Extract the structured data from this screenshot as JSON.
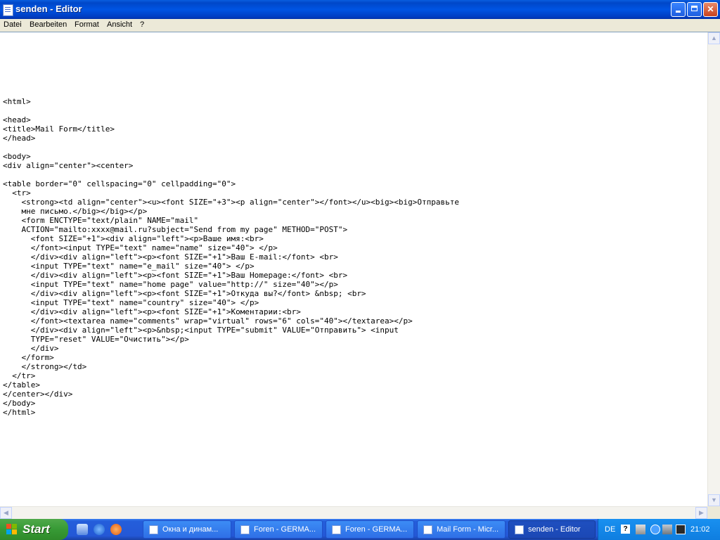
{
  "window": {
    "title": "senden - Editor"
  },
  "menu": [
    "Datei",
    "Bearbeiten",
    "Format",
    "Ansicht",
    "?"
  ],
  "editor": {
    "content": "<html>\n\n<head>\n<title>Mail Form</title>\n</head>\n\n<body>\n<div align=\"center\"><center>\n\n<table border=\"0\" cellspacing=\"0\" cellpadding=\"0\">\n  <tr>\n    <strong><td align=\"center\"><u><font SIZE=\"+3\"><p align=\"center\"></font></u><big><big>Отправьте\n    мне письмо.</big></big></p>\n    <form ENCTYPE=\"text/plain\" NAME=\"mail\"\n    ACTION=\"mailto:xxxx@mail.ru?subject=\"Send from my page\" METHOD=\"POST\">\n      <font SIZE=\"+1\"><div align=\"left\"><p>Ваше имя:<br>\n      </font><input TYPE=\"text\" name=\"name\" size=\"40\"> </p>\n      </div><div align=\"left\"><p><font SIZE=\"+1\">Ваш E-mail:</font> <br>\n      <input TYPE=\"text\" name=\"e_mail\" size=\"40\"> </p>\n      </div><div align=\"left\"><p><font SIZE=\"+1\">Ваш Homepage:</font> <br>\n      <input TYPE=\"text\" name=\"home page\" value=\"http://\" size=\"40\"></p>\n      </div><div align=\"left\"><p><font SIZE=\"+1\">Откуда вы?</font> &nbsp; <br>\n      <input TYPE=\"text\" name=\"country\" size=\"40\"> </p>\n      </div><div align=\"left\"><p><font SIZE=\"+1\">Коментарии:<br>\n      </font><textarea name=\"comments\" wrap=\"virtual\" rows=\"6\" cols=\"40\"></textarea></p>\n      </div><div align=\"left\"><p>&nbsp;<input TYPE=\"submit\" VALUE=\"Отправить\"> <input\n      TYPE=\"reset\" VALUE=\"Очистить\"></p>\n      </div>\n    </form>\n    </strong></td>\n  </tr>\n</table>\n</center></div>\n</body>\n</html>"
  },
  "taskbar": {
    "start_label": "Start",
    "tasks": [
      "Окна и динам...",
      "Foren - GERMA...",
      "Foren - GERMA...",
      "Mail Form - Micr...",
      "senden - Editor"
    ],
    "tray": {
      "language": "DE",
      "help": "?",
      "clock": "21:02"
    }
  },
  "colors": {
    "titlebar": "#0054e3",
    "taskbar": "#245edb",
    "start_button": "#379a35",
    "tray": "#0f7ee0"
  }
}
